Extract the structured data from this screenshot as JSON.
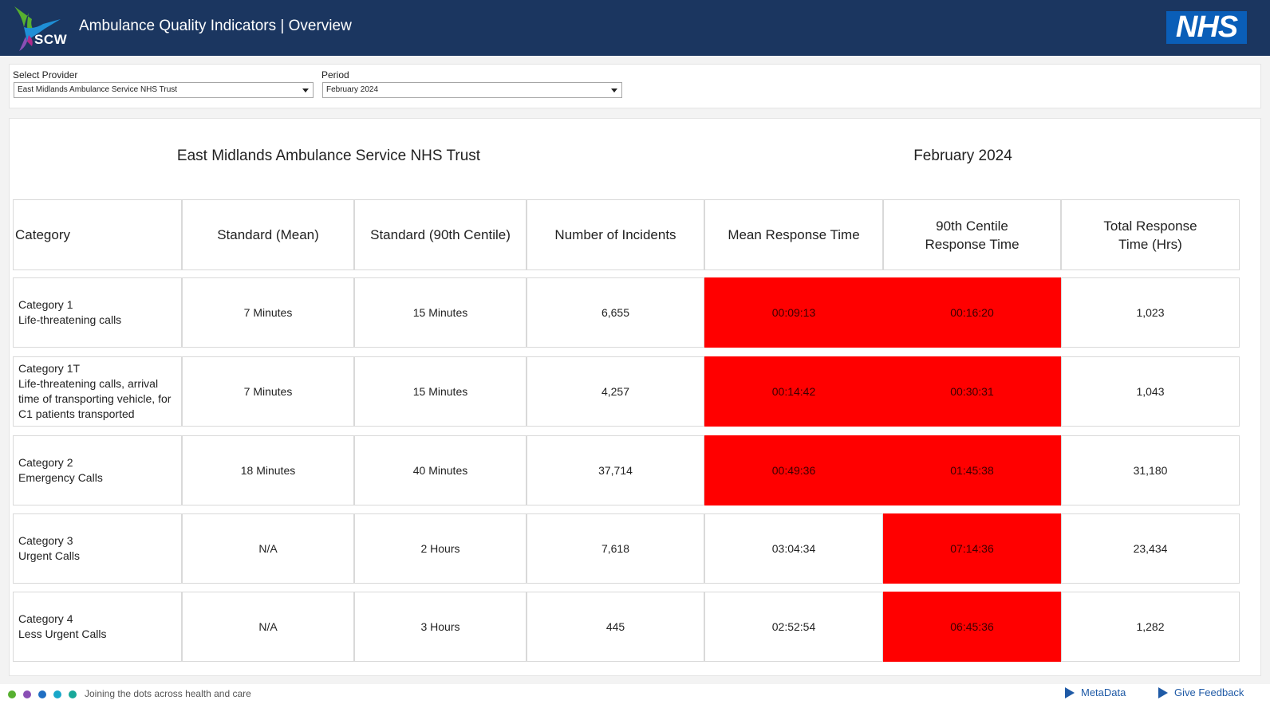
{
  "header": {
    "logo_text": "SCW",
    "title": "Ambulance Quality Indicators | Overview",
    "nhs_logo": "NHS"
  },
  "filters": {
    "provider_label": "Select Provider",
    "provider_value": "East Midlands Ambulance Service NHS Trust",
    "period_label": "Period",
    "period_value": "February 2024"
  },
  "report": {
    "provider_heading": "East Midlands Ambulance Service NHS Trust",
    "period_heading": "February 2024",
    "columns": [
      "Category",
      "Standard (Mean)",
      "Standard (90th Centile)",
      "Number of Incidents",
      "Mean Response Time",
      "90th Centile Response Time",
      "Total Response Time (Hrs)"
    ],
    "rows": [
      {
        "category": [
          "Category 1",
          "Life-threatening calls"
        ],
        "standard_mean": "7 Minutes",
        "standard_90th": "15 Minutes",
        "incidents": "6,655",
        "mean_response": "00:09:13",
        "p90_response": "00:16:20",
        "total_hrs": "1,023",
        "mean_breach": true,
        "p90_breach": true
      },
      {
        "category": [
          "Category 1T",
          "Life-threatening calls, arrival",
          "time of transporting vehicle, for",
          "C1 patients transported"
        ],
        "standard_mean": "7 Minutes",
        "standard_90th": "15 Minutes",
        "incidents": "4,257",
        "mean_response": "00:14:42",
        "p90_response": "00:30:31",
        "total_hrs": "1,043",
        "mean_breach": true,
        "p90_breach": true
      },
      {
        "category": [
          "Category 2",
          "Emergency Calls"
        ],
        "standard_mean": "18 Minutes",
        "standard_90th": "40 Minutes",
        "incidents": "37,714",
        "mean_response": "00:49:36",
        "p90_response": "01:45:38",
        "total_hrs": "31,180",
        "mean_breach": true,
        "p90_breach": true
      },
      {
        "category": [
          "Category 3",
          "Urgent Calls"
        ],
        "standard_mean": "N/A",
        "standard_90th": "2 Hours",
        "incidents": "7,618",
        "mean_response": "03:04:34",
        "p90_response": "07:14:36",
        "total_hrs": "23,434",
        "mean_breach": false,
        "p90_breach": true
      },
      {
        "category": [
          "Category 4",
          "Less Urgent Calls"
        ],
        "standard_mean": "N/A",
        "standard_90th": "3 Hours",
        "incidents": "445",
        "mean_response": "02:52:54",
        "p90_response": "06:45:36",
        "total_hrs": "1,282",
        "mean_breach": false,
        "p90_breach": true
      }
    ],
    "breach_color": "#ff0000"
  },
  "footer": {
    "tagline": "Joining the dots across health and care",
    "dot_colors": [
      "#57b030",
      "#8a4fb5",
      "#1f6ec2",
      "#19a7c9",
      "#18a89a"
    ],
    "metadata_label": "MetaData",
    "feedback_label": "Give Feedback"
  }
}
